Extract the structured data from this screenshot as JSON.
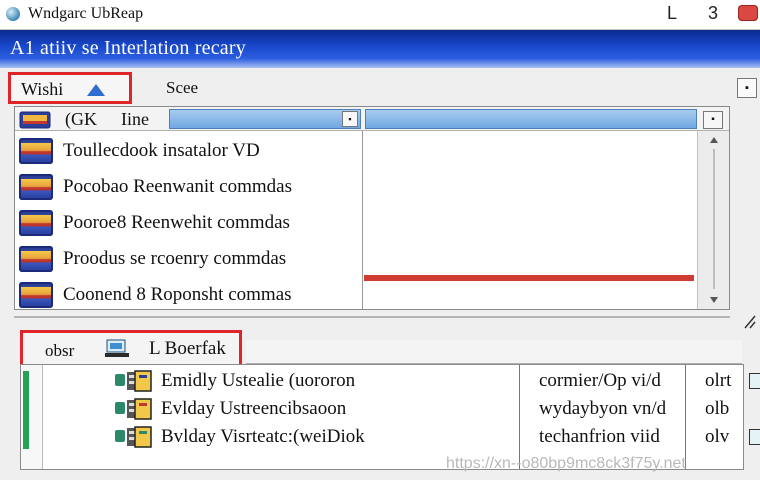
{
  "window": {
    "title": "Wndgarc UbReap",
    "minimize_label": "L",
    "maximize_label": "3"
  },
  "header": {
    "title": "A1 atiiv se Interlation recary"
  },
  "tabs": {
    "wish_label": "Wishi",
    "scee_label": "Scee"
  },
  "list_header": {
    "col1": "(GK",
    "col2": "Iine"
  },
  "list": {
    "items": [
      {
        "label": "Toullecdook insatalor VD"
      },
      {
        "label": "Pocobao Reenwanit commdas"
      },
      {
        "label": "Pooroe8 Reenwehit commdas"
      },
      {
        "label": "Proodus se rcoenry commdas"
      },
      {
        "label": "Coonend 8 Roponsht commas"
      }
    ]
  },
  "lower_tab": {
    "left_label": "obsr",
    "right_label": "L Boerfak"
  },
  "bottom_list": {
    "rows": [
      {
        "name": "Emidly Ustealie (uororon",
        "col2": "cormier/Op vi/d",
        "col3": "olrt"
      },
      {
        "name": "Evlday Ustreencibsaoon",
        "col2": "wydaybyon vn/d",
        "col3": "olb"
      },
      {
        "name": "Bvlday Visrteatc:(weiDiok",
        "col2": "techanfrion viid",
        "col3": "olv"
      }
    ]
  },
  "watermark": "https://xn--o80bp9mc8ck3f75y.net",
  "colors": {
    "accent_red": "#e0252a",
    "header_blue": "#1746c9",
    "selection_blue": "#6fa8e3"
  }
}
